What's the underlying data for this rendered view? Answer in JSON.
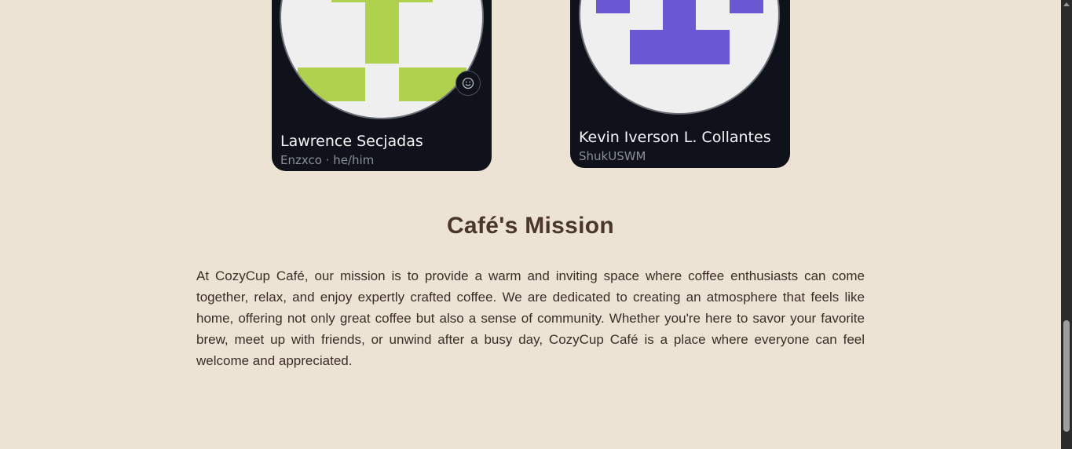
{
  "cards": [
    {
      "name": "Lawrence Secjadas",
      "subtitle": "Enzxco · he/him",
      "avatar_color": "#b0d14d",
      "has_emoji_button": true
    },
    {
      "name": "Kevin Iverson L. Collantes",
      "subtitle": "ShukUSWM",
      "avatar_color": "#6b59d3",
      "has_emoji_button": false
    }
  ],
  "mission": {
    "title": "Café's Mission",
    "text": "At CozyCup Café, our mission is to provide a warm and inviting space where coffee enthusiasts can come together, relax, and enjoy expertly crafted coffee. We are dedicated to creating an atmosphere that feels like home, offering not only great coffee but also a sense of community. Whether you're here to savor your favorite brew, meet up with friends, or unwind after a busy day, CozyCup Café is a place where everyone can feel welcome and appreciated."
  },
  "colors": {
    "page_background": "#ede3d5",
    "card_background": "#0f121a",
    "title_color": "#4a362c"
  },
  "icons": {
    "emoji_button": "smile-icon"
  }
}
